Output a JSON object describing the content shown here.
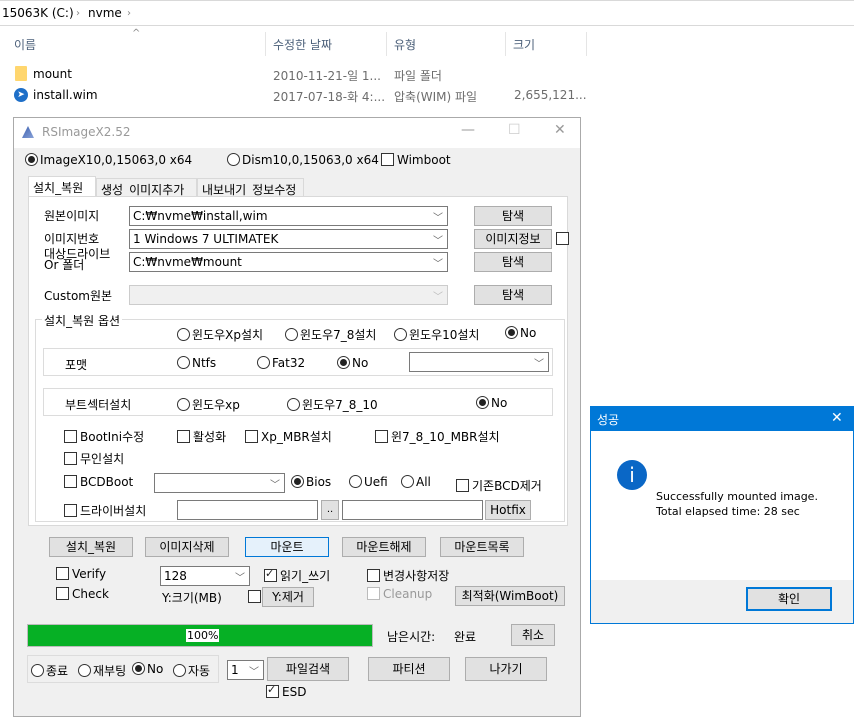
{
  "explorer": {
    "breadcrumb": [
      "15063K (C:)",
      "nvme"
    ],
    "columns": [
      "이름",
      "수정한 날짜",
      "유형",
      "크기"
    ],
    "files": [
      {
        "name": "mount",
        "icon": "folder-icon",
        "date": "2010-11-21-일 1...",
        "type": "파일 폴더",
        "size": ""
      },
      {
        "name": "install.wim",
        "icon": "wim-file-icon",
        "date": "2017-07-18-화 4:...",
        "type": "압축(WIM) 파일",
        "size": "2,655,121..."
      }
    ]
  },
  "app": {
    "title": "RSImageX2.52",
    "minimize": "—",
    "maximize": "☐",
    "close": "✕",
    "engine_options": [
      {
        "label": "ImageX10,0,15063,0 x64",
        "selected": true
      },
      {
        "label": "Dism10,0,15063,0 x64",
        "selected": false
      }
    ],
    "wimboot_label": "Wimboot",
    "tabs": [
      "설치_복원",
      "생성_이미지추가",
      "내보내기_정보수정"
    ],
    "fields": {
      "source_label": "원본이미지",
      "source_value": "C:₩nvme₩install,wim",
      "index_label": "이미지번호",
      "index_value": "1  Windows 7 ULTIMATEK",
      "target_label_1": "대상드라이브",
      "target_label_2": "Or 폴더",
      "target_value": "C:₩nvme₩mount",
      "custom_label": "Custom원본",
      "custom_value": "",
      "browse": "탐색",
      "image_info": "이미지정보"
    },
    "options_group": {
      "title": "설치_복원 옵션",
      "install_os": [
        "윈도우Xp설치",
        "윈도우7_8설치",
        "윈도우10설치",
        "No"
      ],
      "format_label": "포맷",
      "format_options": [
        "Ntfs",
        "Fat32",
        "No"
      ],
      "bootsector_label": "부트섹터설치",
      "bootsector_options": [
        "윈도우xp",
        "윈도우7_8_10",
        "No"
      ],
      "checks": [
        "BootIni수정",
        "활성화",
        "Xp_MBR설치",
        "윈7_8_10_MBR설치",
        "무인설치"
      ],
      "bcdboot_label": "BCDBoot",
      "firmware_options": [
        "Bios",
        "Uefi",
        "All"
      ],
      "remove_bcd": "기존BCD제거",
      "driver_label": "드라이버설치",
      "browse_small": "..",
      "hotfix": "Hotfix"
    },
    "actions": [
      "설치_복원",
      "이미지삭제",
      "마운트",
      "마운트해제",
      "마운트목록"
    ],
    "mount_opts": {
      "verify": "Verify",
      "check": "Check",
      "size_value": "128",
      "size_label": "Y:크기(MB)",
      "readwrite": "읽기_쓰기",
      "y_remove": "Y:제거",
      "save_changes": "변경사항저장",
      "cleanup": "Cleanup",
      "optimize": "최적화(WimBoot)"
    },
    "progress": {
      "percent": 100,
      "label": "100%",
      "remaining_label": "남은시간:",
      "remaining_value": "완료",
      "cancel": "취소"
    },
    "after_options": [
      "종료",
      "재부팅",
      "No",
      "자동"
    ],
    "count_value": "1",
    "esd_label": "ESD",
    "bottom_buttons": [
      "파일검색",
      "파티션",
      "나가기"
    ]
  },
  "dialog": {
    "title": "성공",
    "close": "✕",
    "message_1": "Successfully mounted image.",
    "message_2": "Total elapsed time: 28 sec",
    "ok": "확인",
    "icon_glyph": "i"
  },
  "colors": {
    "accent": "#0078d7",
    "progress": "#06b025"
  }
}
